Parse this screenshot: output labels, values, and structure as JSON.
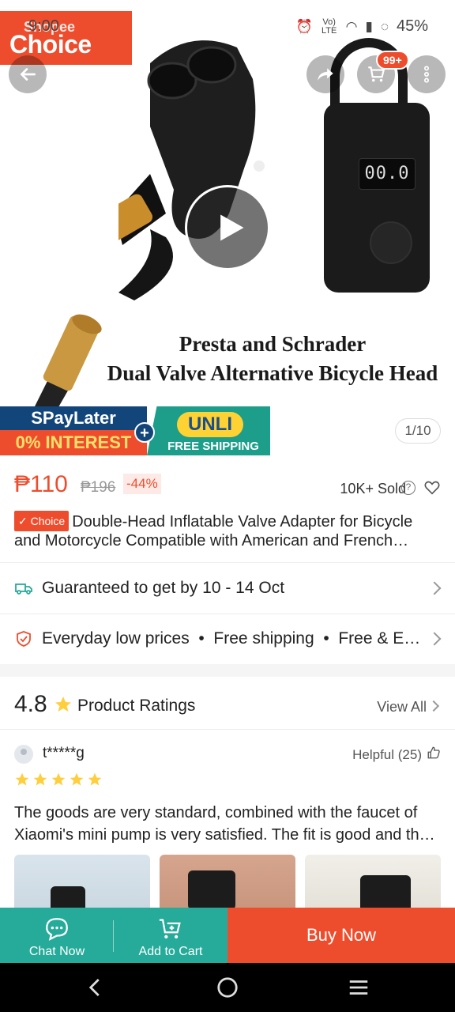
{
  "status_bar": {
    "time": "9:00",
    "battery": "45%",
    "network_label": "Vo) LTE"
  },
  "brand": {
    "top": "Shopee",
    "main": "Choice"
  },
  "hero": {
    "cart_badge": "99+",
    "caption_line1": "Presta and Schrader",
    "caption_line2": "Dual Valve Alternative Bicycle Head",
    "pump_display": "00.0",
    "image_counter": "1/10"
  },
  "promo": {
    "spay_top": "SPayLater",
    "spay_bottom": "0% INTEREST",
    "plus": "+",
    "unli_top": "UNLI",
    "unli_bottom": "FREE SHIPPING"
  },
  "price": {
    "current": "₱110",
    "original": "₱196",
    "discount": "-44%",
    "sold": "10K+ Sold"
  },
  "product": {
    "choice_tag": "✓ Choice",
    "title": "Double-Head Inflatable Valve Adapter for Bicycle and Motorcycle Compatible with American and French valves"
  },
  "info_rows": {
    "delivery": "Guaranteed to get by 10 - 14 Oct",
    "benefits": "Everyday low prices  •  Free shipping  •  Free & Easy Returns"
  },
  "ratings": {
    "score": "4.8",
    "label": "Product Ratings",
    "view_all": "View All"
  },
  "review": {
    "user": "t*****g",
    "helpful": "Helpful (25)",
    "stars": 5,
    "text": "The goods are very standard, combined with the faucet of Xiaomi's mini pump is very satisfied. The fit is good and the quality is excellent."
  },
  "bottom_bar": {
    "chat_label": "Chat Now",
    "cart_label": "Add to Cart",
    "buy_label": "Buy Now"
  },
  "colors": {
    "accent": "#ee4d2d",
    "teal": "#26aa99",
    "star": "#ffce3d"
  },
  "icons": [
    "back-icon",
    "share-icon",
    "cart-icon",
    "more-icon",
    "play-icon",
    "truck-icon",
    "shield-icon",
    "star-icon",
    "heart-icon",
    "help-icon",
    "thumb-up-icon",
    "chat-icon",
    "add-to-cart-icon"
  ]
}
